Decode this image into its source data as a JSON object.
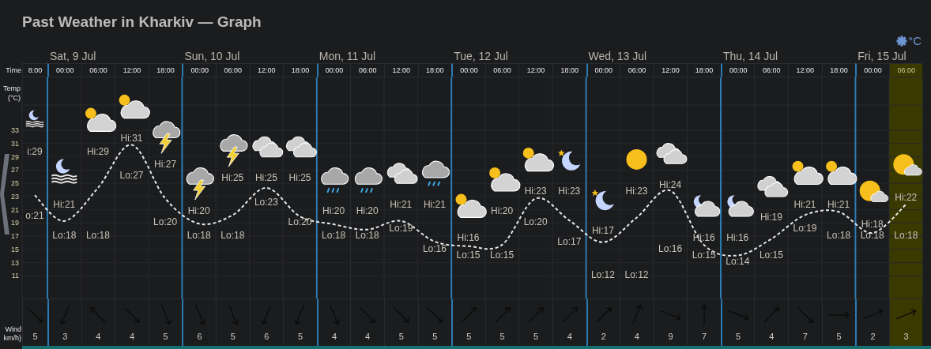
{
  "title": "Past Weather in Kharkiv — Graph",
  "units_button": "°C",
  "axis": {
    "time_label": "Time",
    "wind_label": [
      "Wind",
      "km/h)"
    ]
  },
  "days": [
    {
      "slots": [
        {
          "time": "8:00",
          "weather": {
            "kind": "moon-fog"
          },
          "hi": "i:29",
          "lo": "o:21",
          "wind": {
            "kind": "se",
            "speed": "5"
          },
          "highlighted": false
        }
      ]
    },
    {
      "label": "Sat, 9 Jul",
      "slots": [
        {
          "time": "00:00",
          "weather": {
            "kind": "moon-fog"
          },
          "hi": "Hi:21",
          "lo": "Lo:18",
          "wind": {
            "kind": "ssw",
            "speed": "3"
          },
          "highlighted": false
        },
        {
          "time": "06:00",
          "weather": {
            "kind": "partly-cloudy"
          },
          "hi": "Hi:29",
          "lo": "Lo:18",
          "wind": {
            "kind": "nw",
            "speed": "4"
          },
          "highlighted": false
        },
        {
          "time": "12:00",
          "weather": {
            "kind": "partly-cloudy"
          },
          "hi": "Hi:31",
          "lo": "Lo:27",
          "wind": {
            "kind": "se",
            "speed": "4"
          },
          "highlighted": false
        },
        {
          "time": "18:00",
          "weather": {
            "kind": "thunderstorm"
          },
          "hi": "Hi:27",
          "lo": "Lo:20",
          "wind": {
            "kind": "sse",
            "speed": "5"
          },
          "highlighted": false
        }
      ]
    },
    {
      "label": "Sun, 10 Jul",
      "slots": [
        {
          "time": "00:00",
          "weather": {
            "kind": "thunderstorm"
          },
          "hi": "Hi:20",
          "lo": "Lo:18",
          "wind": {
            "kind": "sse",
            "speed": "6"
          },
          "highlighted": false
        },
        {
          "time": "06:00",
          "weather": {
            "kind": "thunderstorm"
          },
          "hi": "Hi:25",
          "lo": "Lo:18",
          "wind": {
            "kind": "sse",
            "speed": "5"
          },
          "highlighted": false
        },
        {
          "time": "12:00",
          "weather": {
            "kind": "cloudy"
          },
          "hi": "Hi:25",
          "lo": "Lo:23",
          "wind": {
            "kind": "ssw",
            "speed": "6"
          },
          "highlighted": false
        },
        {
          "time": "18:00",
          "weather": {
            "kind": "cloudy"
          },
          "hi": "Hi:25",
          "lo": "Lo:20",
          "wind": {
            "kind": "ssw",
            "speed": "5"
          },
          "highlighted": false
        }
      ]
    },
    {
      "label": "Mon, 11 Jul",
      "slots": [
        {
          "time": "00:00",
          "weather": {
            "kind": "rain"
          },
          "hi": "Hi:20",
          "lo": "Lo:18",
          "wind": {
            "kind": "sse",
            "speed": "4"
          },
          "highlighted": false
        },
        {
          "time": "06:00",
          "weather": {
            "kind": "rain"
          },
          "hi": "Hi:20",
          "lo": "Lo:18",
          "wind": {
            "kind": "se",
            "speed": "4"
          },
          "highlighted": false
        },
        {
          "time": "12:00",
          "weather": {
            "kind": "cloudy"
          },
          "hi": "Hi:21",
          "lo": "Lo:19",
          "wind": {
            "kind": "se",
            "speed": "5"
          },
          "highlighted": false
        },
        {
          "time": "18:00",
          "weather": {
            "kind": "rain"
          },
          "hi": "Hi:21",
          "lo": "Lo:16",
          "wind": {
            "kind": "se",
            "speed": "5"
          },
          "highlighted": false
        }
      ]
    },
    {
      "label": "Tue, 12 Jul",
      "slots": [
        {
          "time": "00:00",
          "weather": {
            "kind": "partly-cloudy"
          },
          "hi": "Hi:16",
          "lo": "Lo:15",
          "wind": {
            "kind": "ne",
            "speed": "5"
          },
          "highlighted": false
        },
        {
          "time": "06:00",
          "weather": {
            "kind": "partly-cloudy"
          },
          "hi": "Hi:20",
          "lo": "Lo:15",
          "wind": {
            "kind": "ne",
            "speed": "5"
          },
          "highlighted": false
        },
        {
          "time": "12:00",
          "weather": {
            "kind": "partly-cloudy"
          },
          "hi": "Hi:23",
          "lo": "Lo:20",
          "wind": {
            "kind": "ne",
            "speed": "5"
          },
          "highlighted": false
        },
        {
          "time": "18:00",
          "weather": {
            "kind": "clear-night"
          },
          "hi": "Hi:23",
          "lo": "Lo:17",
          "wind": {
            "kind": "ne",
            "speed": "4"
          },
          "highlighted": false
        }
      ]
    },
    {
      "label": "Wed, 13 Jul",
      "slots": [
        {
          "time": "00:00",
          "weather": {
            "kind": "clear-night"
          },
          "hi": "Hi:17",
          "lo": "Lo:12",
          "wind": {
            "kind": "ne",
            "speed": "2"
          },
          "highlighted": false
        },
        {
          "time": "06:00",
          "weather": {
            "kind": "sunny"
          },
          "hi": "Hi:23",
          "lo": "Lo:12",
          "wind": {
            "kind": "nne",
            "speed": "4"
          },
          "highlighted": false
        },
        {
          "time": "12:00",
          "weather": {
            "kind": "cloudy"
          },
          "hi": "Hi:24",
          "lo": "Lo:16",
          "wind": {
            "kind": "ese",
            "speed": "9"
          },
          "highlighted": false
        },
        {
          "time": "18:00",
          "weather": {
            "kind": "cloudy-night"
          },
          "hi": "Hi:16",
          "lo": "Lo:15",
          "wind": {
            "kind": "n",
            "speed": "7"
          },
          "highlighted": false
        }
      ]
    },
    {
      "label": "Thu, 14 Jul",
      "slots": [
        {
          "time": "00:00",
          "weather": {
            "kind": "cloudy-night"
          },
          "hi": "Hi:16",
          "lo": "Lo:14",
          "wind": {
            "kind": "ese",
            "speed": "5"
          },
          "highlighted": false
        },
        {
          "time": "06:00",
          "weather": {
            "kind": "cloudy"
          },
          "hi": "Hi:19",
          "lo": "Lo:15",
          "wind": {
            "kind": "ne",
            "speed": "4"
          },
          "highlighted": false
        },
        {
          "time": "12:00",
          "weather": {
            "kind": "partly-cloudy"
          },
          "hi": "Hi:21",
          "lo": "Lo:19",
          "wind": {
            "kind": "se",
            "speed": "7"
          },
          "highlighted": false
        },
        {
          "time": "18:00",
          "weather": {
            "kind": "partly-cloudy"
          },
          "hi": "Hi:21",
          "lo": "Lo:18",
          "wind": {
            "kind": "e",
            "speed": "5"
          },
          "highlighted": false
        }
      ]
    },
    {
      "label": "Fri, 15 Jul",
      "slots": [
        {
          "time": "00:00",
          "weather": {
            "kind": "sun-cloud"
          },
          "hi": "Hi:18",
          "lo": "Lo:18",
          "wind": {
            "kind": "ene",
            "speed": "2"
          },
          "highlighted": false
        },
        {
          "time": "06:00",
          "weather": {
            "kind": "sun-cloud"
          },
          "hi": "Hi:22",
          "lo": "Lo:18",
          "wind": {
            "kind": "ene",
            "speed": "3"
          },
          "highlighted": true
        }
      ]
    }
  ],
  "temperature": {
    "chart_data": {
      "type": "line",
      "ylabel": "Temp (°C)",
      "ylim": [
        0.4,
        41
      ],
      "yticks": [
        11,
        13,
        15,
        17,
        19,
        21,
        23,
        25,
        27,
        29,
        31,
        33
      ],
      "grid": true,
      "line_style": "dashed",
      "values": [
        23.2,
        19.3,
        24.3,
        30.8,
        22.7,
        18.9,
        20.2,
        24.3,
        20.0,
        18.8,
        18.0,
        19.3,
        16.2,
        15.5,
        15.7,
        22.7,
        19.4,
        16.1,
        19.8,
        23.9,
        15.7,
        14.1,
        16.6,
        20.2,
        20.7,
        17.5,
        21.8
      ]
    }
  }
}
